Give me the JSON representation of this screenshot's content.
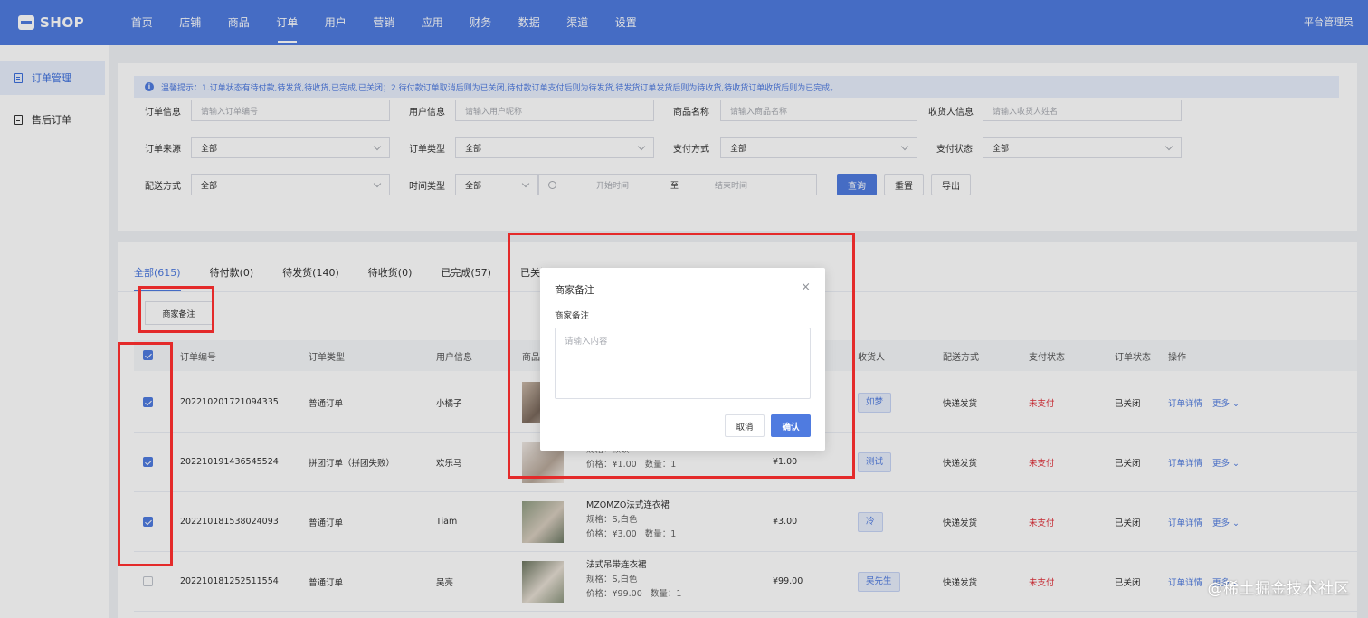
{
  "header": {
    "logo": "SHOP",
    "nav": [
      "首页",
      "店铺",
      "商品",
      "订单",
      "用户",
      "营销",
      "应用",
      "财务",
      "数据",
      "渠道",
      "设置"
    ],
    "active_index": 3,
    "admin": "平台管理员"
  },
  "sidebar": {
    "items": [
      {
        "label": "订单管理"
      },
      {
        "label": "售后订单"
      }
    ]
  },
  "tip": "温馨提示：1.订单状态有待付款,待发货,待收货,已完成,已关闭；2.待付款订单取消后则为已关闭,待付款订单支付后则为待发货,待发货订单发货后则为待收货,待收货订单收货后则为已完成。",
  "filters": {
    "order_info": {
      "label": "订单信息",
      "placeholder": "请输入订单编号"
    },
    "user_info": {
      "label": "用户信息",
      "placeholder": "请输入用户昵称"
    },
    "goods_name": {
      "label": "商品名称",
      "placeholder": "请输入商品名称"
    },
    "receiver": {
      "label": "收货人信息",
      "placeholder": "请输入收货人姓名"
    },
    "order_source": {
      "label": "订单来源",
      "value": "全部"
    },
    "order_type": {
      "label": "订单类型",
      "value": "全部"
    },
    "pay_method": {
      "label": "支付方式",
      "value": "全部"
    },
    "pay_status": {
      "label": "支付状态",
      "value": "全部"
    },
    "delivery": {
      "label": "配送方式",
      "value": "全部"
    },
    "time_type": {
      "label": "时间类型",
      "value": "全部"
    },
    "start_placeholder": "开始时间",
    "to": "至",
    "end_placeholder": "结束时间",
    "query": "查询",
    "reset": "重置",
    "export": "导出"
  },
  "tabs": [
    {
      "label": "全部(615)"
    },
    {
      "label": "待付款(0)"
    },
    {
      "label": "待发货(140)"
    },
    {
      "label": "待收货(0)"
    },
    {
      "label": "已完成(57)"
    },
    {
      "label": "已关闭("
    }
  ],
  "remark_button": "商家备注",
  "table": {
    "headers": {
      "order_no": "订单编号",
      "order_type": "订单类型",
      "user": "用户信息",
      "goods": "商品",
      "receiver": "收货人",
      "delivery": "配送方式",
      "pay_status": "支付状态",
      "order_status": "订单状态",
      "actions": "操作"
    },
    "rows": [
      {
        "checked": true,
        "order_no": "202210201721094335",
        "order_type": "普通订单",
        "user": "小橘子",
        "goods_name": "",
        "spec": "",
        "price": "",
        "qty": "",
        "amount": "",
        "receiver": "如梦",
        "delivery": "快递发货",
        "pay_status": "未支付",
        "order_status": "已关闭",
        "detail": "订单详情",
        "more": "更多"
      },
      {
        "checked": true,
        "order_no": "202210191436545524",
        "order_type": "拼团订单（拼团失败）",
        "user": "欢乐马",
        "goods_name": "",
        "spec": "规格：默认",
        "price": "价格：¥1.00",
        "qty": "数量：1",
        "amount": "¥1.00",
        "receiver": "测试",
        "delivery": "快递发货",
        "pay_status": "未支付",
        "order_status": "已关闭",
        "detail": "订单详情",
        "more": "更多"
      },
      {
        "checked": true,
        "order_no": "202210181538024093",
        "order_type": "普通订单",
        "user": "Tiam",
        "goods_name": "MZOMZO法式连衣裙",
        "spec": "规格：S,白色",
        "price": "价格：¥3.00",
        "qty": "数量：1",
        "amount": "¥3.00",
        "receiver": "冷",
        "delivery": "快递发货",
        "pay_status": "未支付",
        "order_status": "已关闭",
        "detail": "订单详情",
        "more": "更多"
      },
      {
        "checked": false,
        "order_no": "202210181252511554",
        "order_type": "普通订单",
        "user": "吴亮",
        "goods_name": "法式吊带连衣裙",
        "spec": "规格：S,白色",
        "price": "价格：¥99.00",
        "qty": "数量：1",
        "amount": "¥99.00",
        "receiver": "吴先生",
        "delivery": "快递发货",
        "pay_status": "未支付",
        "order_status": "已关闭",
        "detail": "订单详情",
        "more": "更多"
      }
    ]
  },
  "dialog": {
    "title": "商家备注",
    "close": "×",
    "label": "商家备注",
    "placeholder": "请输入内容",
    "cancel": "取消",
    "confirm": "确认"
  },
  "watermark": "@稀土掘金技术社区",
  "colors": {
    "primary": "#4f7be0",
    "annotation_red": "#e42a2a",
    "unpaid_red": "#e0303a"
  }
}
